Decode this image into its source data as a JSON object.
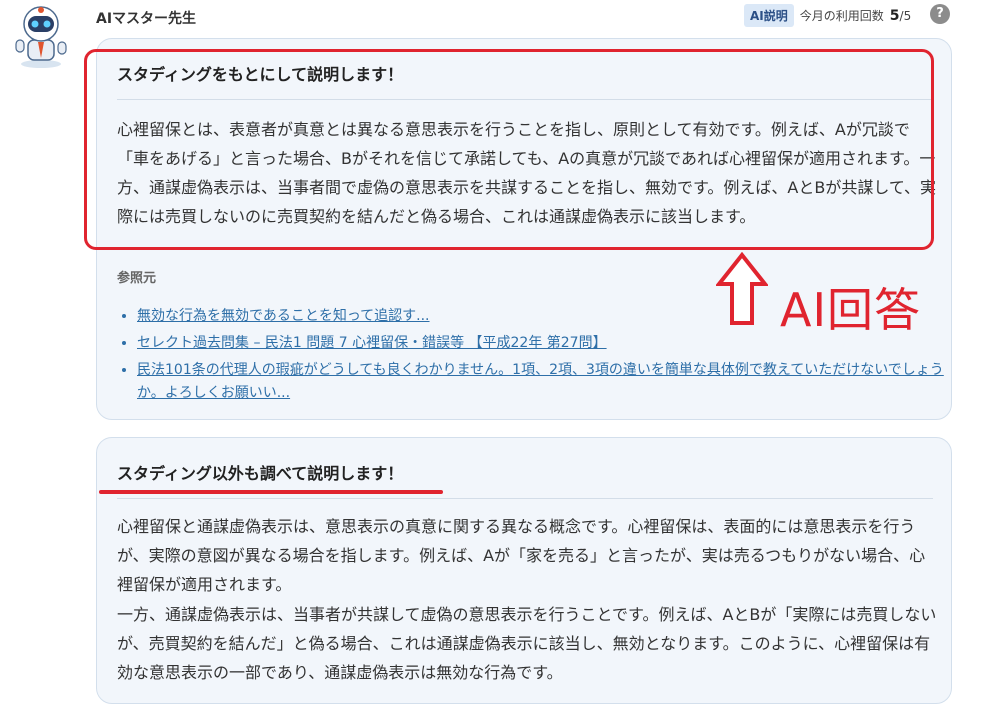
{
  "header": {
    "assistant_name": "AIマスター先生",
    "badge": "AI説明",
    "usage_label": "今月の利用回数",
    "usage_count": "5",
    "usage_total": "/5",
    "help": "?"
  },
  "card1": {
    "title": "スタディングをもとにして説明します！",
    "paragraph": "心裡留保とは、表意者が真意とは異なる意思表示を行うことを指し、原則として有効です。例えば、Aが冗談で「車をあげる」と言った場合、Bがそれを信じて承諾しても、Aの真意が冗談であれば心裡留保が適用されます。一方、通謀虚偽表示は、当事者間で虚偽の意思表示を共謀することを指し、無効です。例えば、AとBが共謀して、実際には売買しないのに売買契約を結んだと偽る場合、これは通謀虚偽表示に該当します。",
    "refs_label": "参照元",
    "refs": [
      "無効な行為を無効であることを知って追認す...",
      "セレクト過去問集 – 民法1 問題 7 心裡留保・錯誤等 【平成22年 第27問】",
      "民法101条の代理人の瑕疵がどうしても良くわかりません。1項、2項、3項の違いを簡単な具体例で教えていただけないでしょうか。よろしくお願いい..."
    ]
  },
  "card2": {
    "title": "スタディング以外も調べて説明します！",
    "paragraph1": "心裡留保と通謀虚偽表示は、意思表示の真意に関する異なる概念です。心裡留保は、表面的には意思表示を行うが、実際の意図が異なる場合を指します。例えば、Aが「家を売る」と言ったが、実は売るつもりがない場合、心裡留保が適用されます。",
    "paragraph2": "一方、通謀虚偽表示は、当事者が共謀して虚偽の意思表示を行うことです。例えば、AとBが「実際には売買しないが、売買契約を結んだ」と偽る場合、これは通謀虚偽表示に該当し、無効となります。このように、心裡留保は有効な意思表示の一部であり、通謀虚偽表示は無効な行為です。"
  },
  "annotation": {
    "label": "AI回答",
    "color": "#e0242f"
  }
}
